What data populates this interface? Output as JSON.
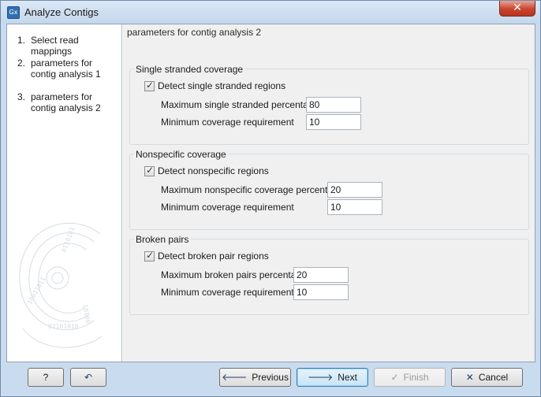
{
  "window": {
    "title": "Analyze Contigs",
    "app_icon": "Gx"
  },
  "steps": [
    {
      "num": "1.",
      "label": "Select read mappings"
    },
    {
      "num": "2.",
      "label": "parameters for contig analysis 1"
    },
    {
      "num": "3.",
      "label": "parameters for contig analysis 2"
    }
  ],
  "main": {
    "title": "parameters for contig analysis 2",
    "groups": [
      {
        "title": "Single stranded coverage",
        "checkbox_label": "Detect single stranded regions",
        "checked": true,
        "fields": [
          {
            "label": "Maximum single stranded percentage",
            "value": "80"
          },
          {
            "label": "Minimum coverage requirement",
            "value": "10"
          }
        ]
      },
      {
        "title": "Nonspecific coverage",
        "checkbox_label": "Detect nonspecific regions",
        "checked": true,
        "fields": [
          {
            "label": "Maximum nonspecific coverage percentage",
            "value": "20"
          },
          {
            "label": "Minimum coverage requirement",
            "value": "10"
          }
        ]
      },
      {
        "title": "Broken pairs",
        "checkbox_label": "Detect broken pair regions",
        "checked": true,
        "fields": [
          {
            "label": "Maximum broken pairs percentage",
            "value": "20"
          },
          {
            "label": "Minimum coverage requirement",
            "value": "10"
          }
        ]
      }
    ]
  },
  "footer": {
    "help": "?",
    "previous": "Previous",
    "next": "Next",
    "finish": "Finish",
    "cancel": "Cancel"
  },
  "colors": {
    "arrow": "#1f3f66",
    "cancel_x": "#1f3f66",
    "close": "#c8452f"
  }
}
